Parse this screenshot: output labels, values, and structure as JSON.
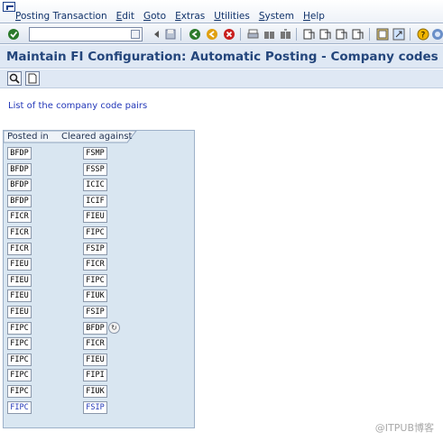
{
  "menubar": {
    "items": [
      "Posting Transaction",
      "Edit",
      "Goto",
      "Extras",
      "Utilities",
      "System",
      "Help"
    ]
  },
  "toolbar": {
    "command_field_value": "",
    "icons": [
      "enter-icon",
      "back-icon",
      "exit-icon",
      "cancel-icon",
      "print-icon",
      "find-icon",
      "find-next-icon",
      "first-page-icon",
      "previous-page-icon",
      "next-page-icon",
      "last-page-icon",
      "create-session-icon",
      "shortcut-icon",
      "help-icon",
      "customize-layout-icon"
    ]
  },
  "title": "Maintain FI Configuration: Automatic Posting - Company codes",
  "app_toolbar": {
    "icons": [
      "details-icon",
      "document-icon"
    ]
  },
  "list_title": "List of the company code pairs",
  "table": {
    "headers": [
      "Posted in",
      "Cleared against"
    ],
    "rows": [
      [
        "BFDP",
        "FSMP"
      ],
      [
        "BFDP",
        "FSSP"
      ],
      [
        "BFDP",
        "ICIC"
      ],
      [
        "BFDP",
        "ICIF"
      ],
      [
        "FICR",
        "FIEU"
      ],
      [
        "FICR",
        "FIPC"
      ],
      [
        "FICR",
        "FSIP"
      ],
      [
        "FIEU",
        "FICR"
      ],
      [
        "FIEU",
        "FIPC"
      ],
      [
        "FIEU",
        "FIUK"
      ],
      [
        "FIEU",
        "FSIP"
      ],
      [
        "FIPC",
        "BFDP"
      ],
      [
        "FIPC",
        "FICR"
      ],
      [
        "FIPC",
        "FIEU"
      ],
      [
        "FIPC",
        "FIPI"
      ],
      [
        "FIPC",
        "FIUK"
      ],
      [
        "FIPC",
        "FSIP"
      ]
    ]
  },
  "watermark": "@ITPUB博客",
  "colors": {
    "title": "#24467c",
    "link": "#2237b8",
    "table_bg": "#d9e6f1"
  }
}
